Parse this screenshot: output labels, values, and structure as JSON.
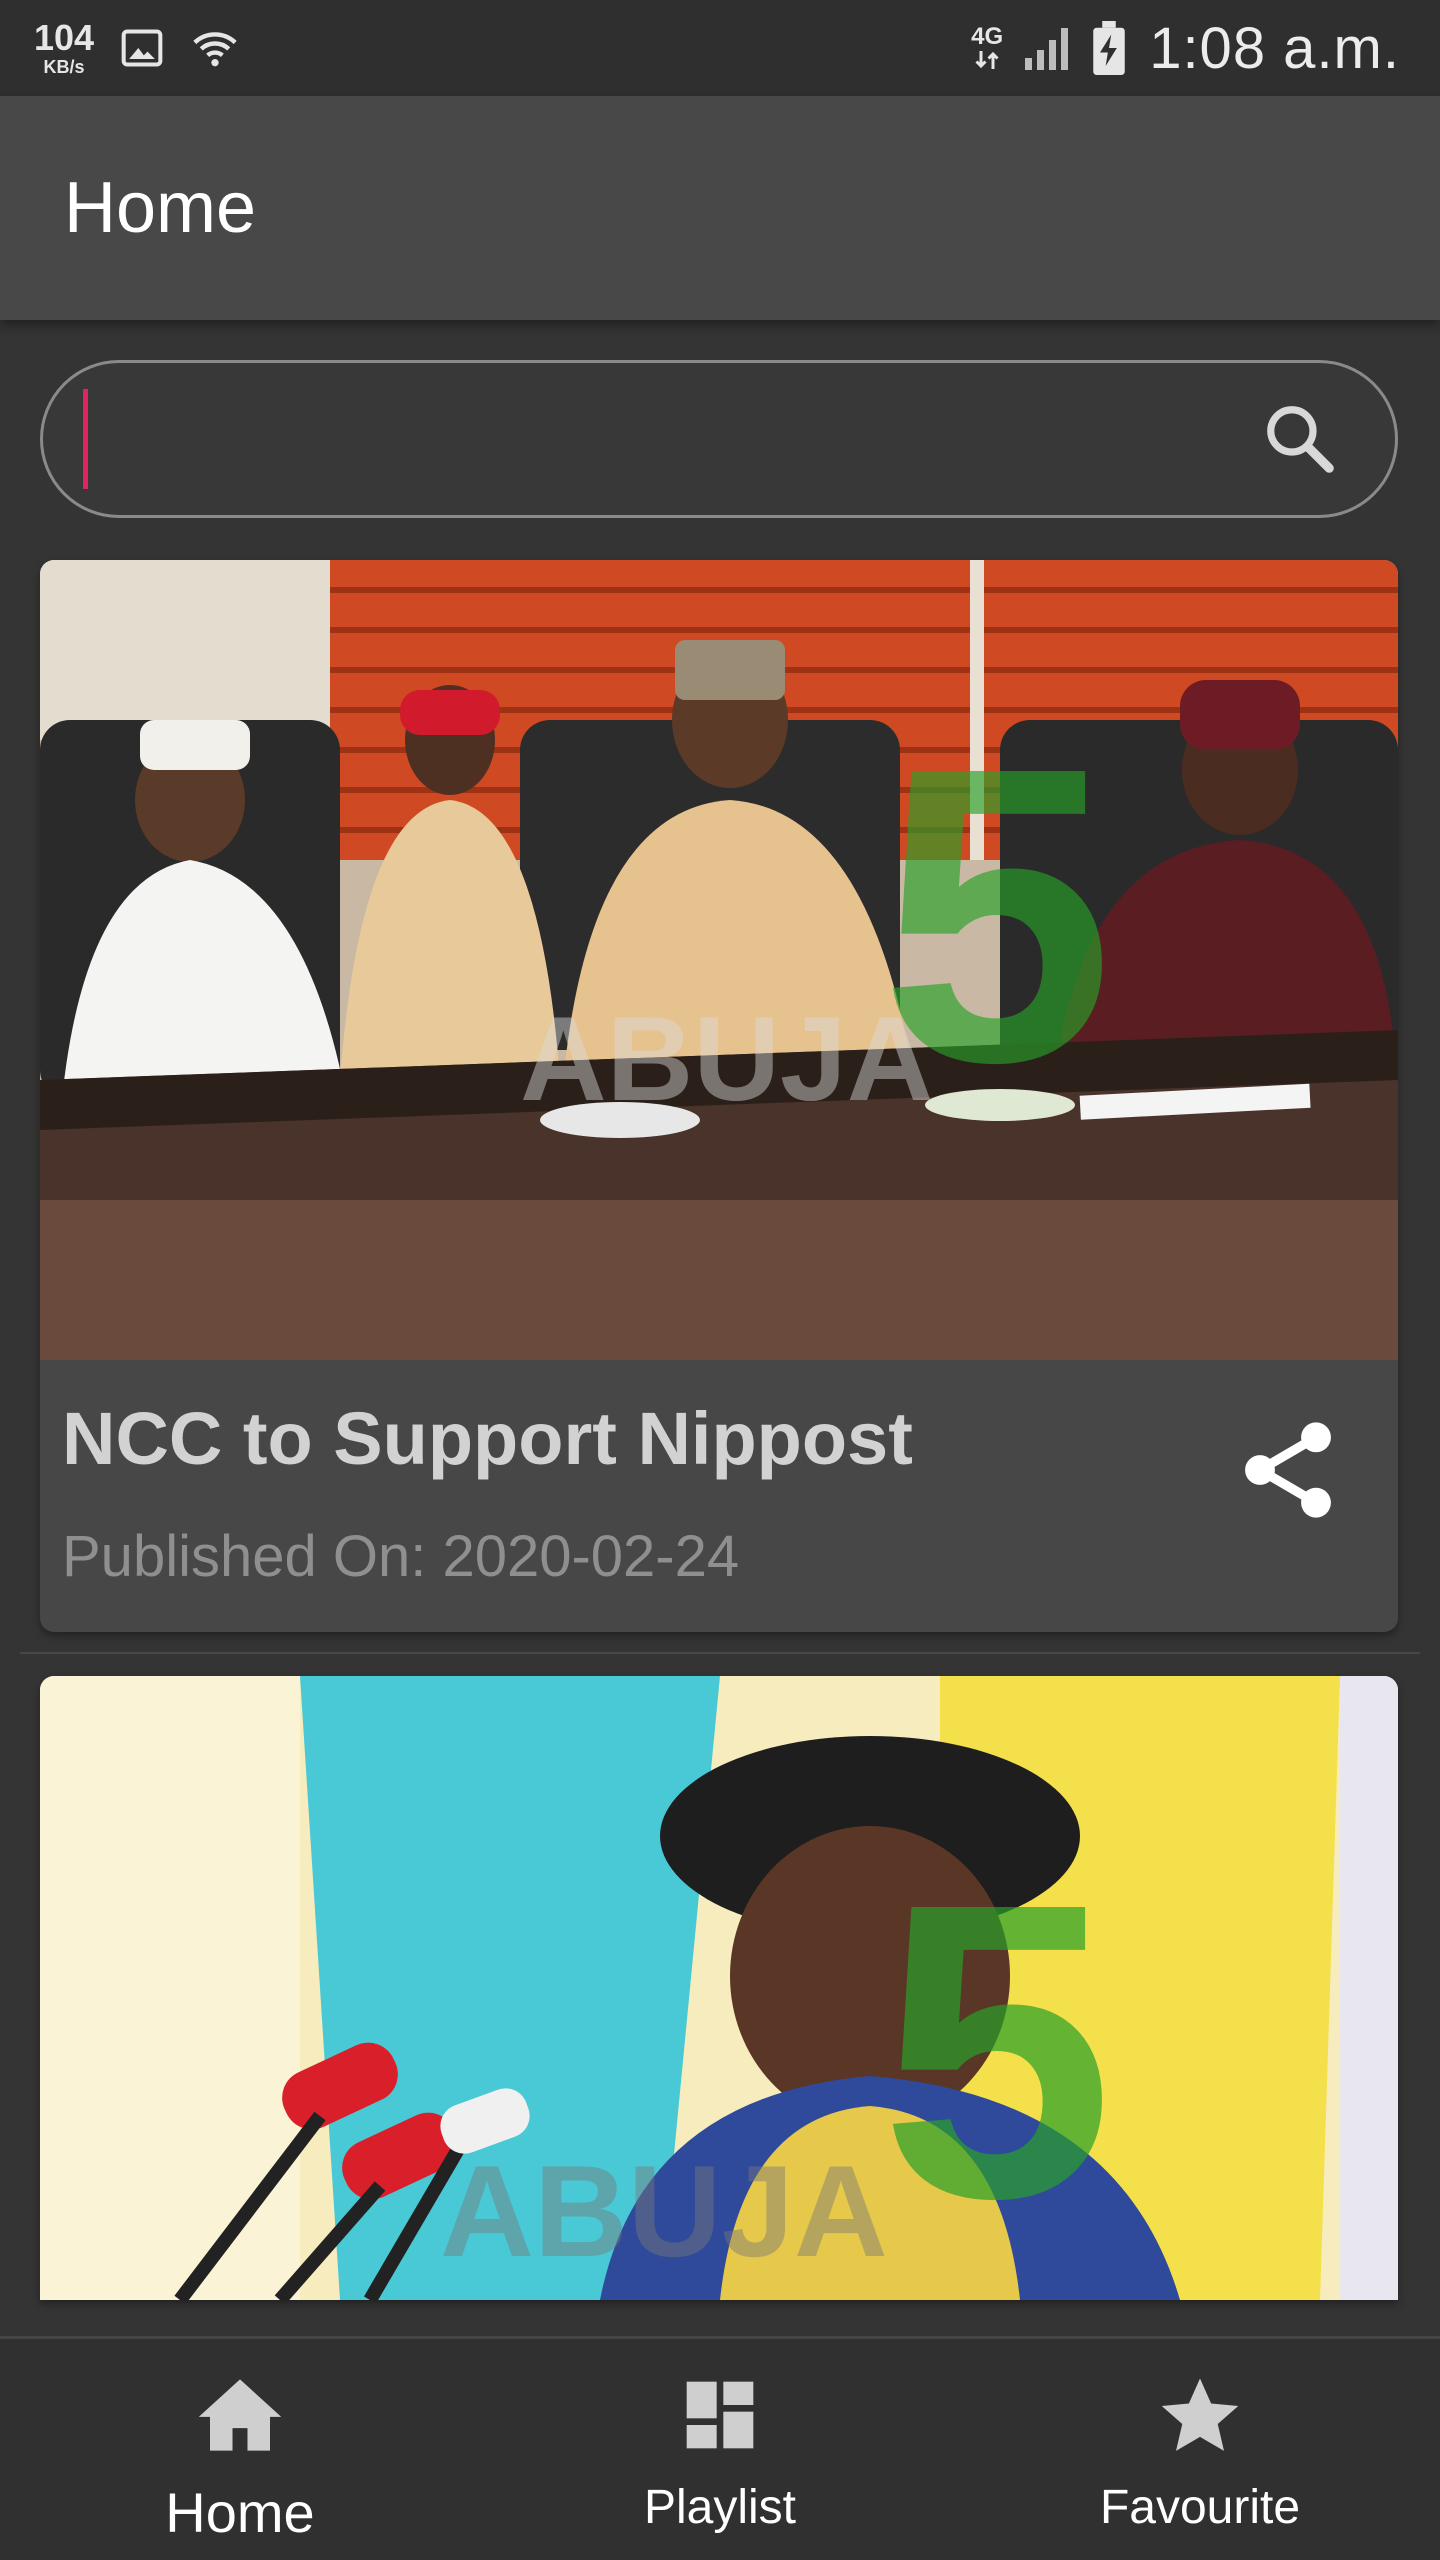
{
  "status_bar": {
    "net_speed": "104",
    "net_unit": "KB/s",
    "network_type": "4G",
    "time": "1:08 a.m.",
    "icons": [
      "image-icon",
      "wifi-icon",
      "signal-icon",
      "battery-charging-icon"
    ]
  },
  "app_bar": {
    "title": "Home"
  },
  "search": {
    "placeholder": "",
    "value": "",
    "icon": "search-icon"
  },
  "videos": [
    {
      "title": "NCC to Support Nippost",
      "published": "Published On: 2020-02-24",
      "watermark_number": "5",
      "watermark_city": "ABUJA",
      "share_icon": "share-icon"
    },
    {
      "title": "",
      "published": "",
      "watermark_number": "5",
      "watermark_city": "ABUJA"
    }
  ],
  "bottom_nav": {
    "items": [
      {
        "label": "Home",
        "icon": "home-icon",
        "active": true
      },
      {
        "label": "Playlist",
        "icon": "playlist-icon",
        "active": false
      },
      {
        "label": "Favourite",
        "icon": "star-icon",
        "active": false
      }
    ]
  },
  "colors": {
    "background": "#343434",
    "app_bar": "#484848",
    "card": "#474747",
    "accent_cursor": "#e0245e",
    "title_text": "#d2d2d2",
    "date_text": "#8f8f8f"
  }
}
